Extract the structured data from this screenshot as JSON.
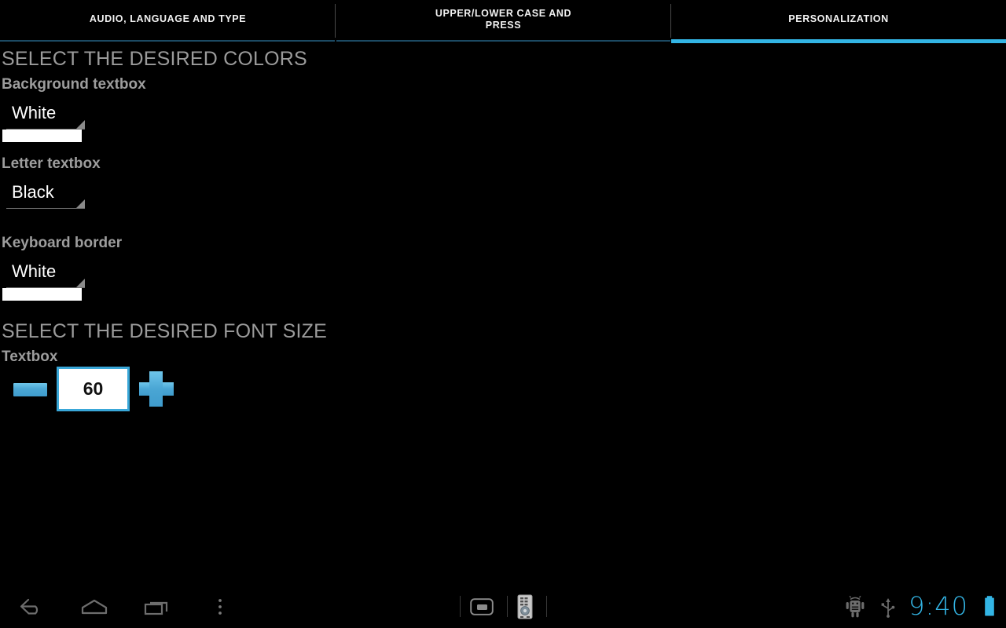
{
  "tabs": [
    {
      "label": "AUDIO, LANGUAGE AND TYPE",
      "active": false
    },
    {
      "label": "UPPER/LOWER CASE AND PRESS",
      "active": false
    },
    {
      "label": "PERSONALIZATION",
      "active": true
    }
  ],
  "colors_section": {
    "header": "SELECT THE DESIRED COLORS",
    "fields": [
      {
        "label": "Background textbox",
        "value": "White",
        "swatch_color": "#ffffff",
        "swatch_visible": true
      },
      {
        "label": "Letter textbox",
        "value": "Black",
        "swatch_color": "#000000",
        "swatch_visible": false
      },
      {
        "label": "Keyboard border",
        "value": "White",
        "swatch_color": "#ffffff",
        "swatch_visible": true
      }
    ]
  },
  "font_section": {
    "header": "SELECT THE DESIRED FONT SIZE",
    "label": "Textbox",
    "value": "60",
    "minus_label": "−",
    "plus_label": "+"
  },
  "navbar": {
    "back_icon": "back-arrow-icon",
    "home_icon": "home-icon",
    "recents_icon": "recent-apps-icon",
    "menu_icon": "overflow-menu-icon",
    "ime_icon": "keyboard-switcher-icon",
    "remote_icon": "remote-control-icon",
    "adb_icon": "android-debug-icon",
    "usb_icon": "usb-icon",
    "clock": "9:40",
    "battery_icon": "battery-full-icon"
  },
  "theme": {
    "accent": "#33b5e5",
    "accent_dim": "#1c4a63",
    "background": "#000000",
    "header_text": "#9b9b9b",
    "label_text": "#9d9d9d",
    "value_text": "#ffffff",
    "nav_icon": "#6b6b6b"
  }
}
